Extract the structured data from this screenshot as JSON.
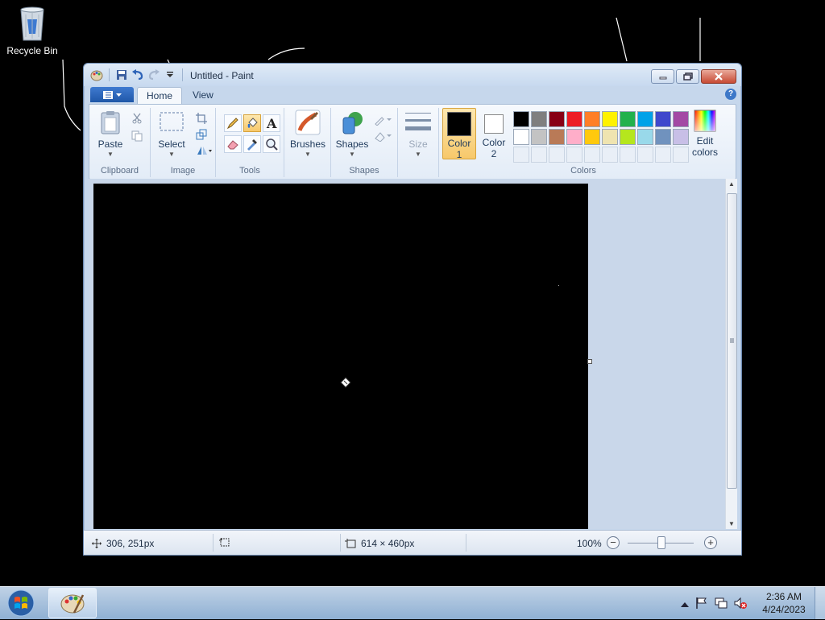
{
  "desktop": {
    "recycle_bin_label": "Recycle Bin"
  },
  "window": {
    "title": "Untitled - Paint"
  },
  "ribbon": {
    "tabs": [
      {
        "label": "Home"
      },
      {
        "label": "View"
      }
    ],
    "groups": {
      "clipboard": {
        "label": "Clipboard",
        "paste": "Paste"
      },
      "image": {
        "label": "Image",
        "select": "Select"
      },
      "tools": {
        "label": "Tools"
      },
      "shapes": {
        "label": "Shapes",
        "brushes": "Brushes",
        "shapes": "Shapes",
        "size": "Size"
      },
      "colors": {
        "label": "Colors",
        "color1": {
          "line1": "Color",
          "line2": "1",
          "value": "#000000"
        },
        "color2": {
          "line1": "Color",
          "line2": "2",
          "value": "#ffffff"
        },
        "edit_colors": {
          "line1": "Edit",
          "line2": "colors"
        },
        "palette_row1": [
          "#000000",
          "#7f7f7f",
          "#880015",
          "#ed1c24",
          "#ff7f27",
          "#fff200",
          "#22b14c",
          "#00a2e8",
          "#3f48cc",
          "#a349a4"
        ],
        "palette_row2": [
          "#ffffff",
          "#c3c3c3",
          "#b97a57",
          "#ffaec9",
          "#ffc90e",
          "#efe4b0",
          "#b5e61d",
          "#99d9ea",
          "#7092be",
          "#c8bfe7"
        ]
      }
    }
  },
  "status": {
    "cursor_position": "306, 251px",
    "image_size": "614 × 460px",
    "zoom": "100%"
  },
  "taskbar": {
    "time": "2:36 AM",
    "date": "4/24/2023"
  }
}
